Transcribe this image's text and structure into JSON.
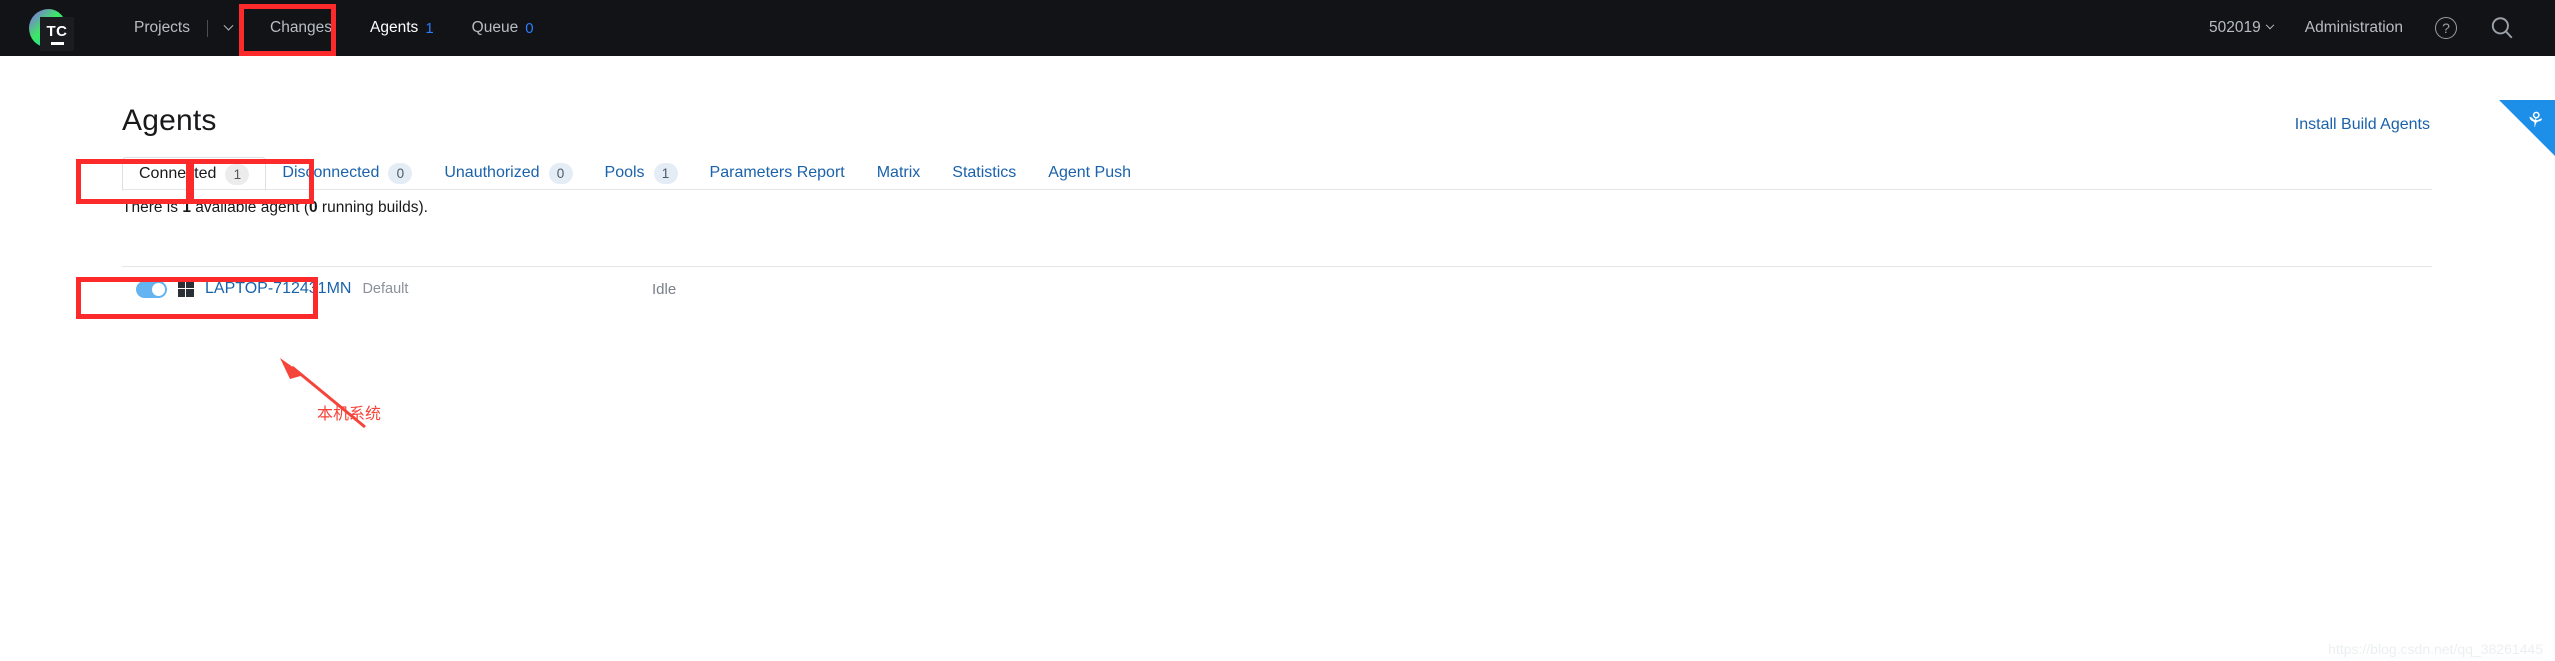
{
  "header": {
    "logo_text": "TC",
    "nav": [
      {
        "label": "Projects",
        "count": "",
        "has_divider": true,
        "has_chevron": true,
        "active": false,
        "name": "projects"
      },
      {
        "label": "Changes",
        "count": "",
        "has_divider": false,
        "has_chevron": false,
        "active": false,
        "name": "changes"
      },
      {
        "label": "Agents",
        "count": "1",
        "has_divider": false,
        "has_chevron": false,
        "active": true,
        "name": "agents"
      },
      {
        "label": "Queue",
        "count": "0",
        "has_divider": false,
        "has_chevron": false,
        "active": false,
        "name": "queue"
      }
    ],
    "user": "502019",
    "administration": "Administration",
    "help_icon": "?",
    "search_icon": "search-icon"
  },
  "page": {
    "title": "Agents",
    "install_link": "Install Build Agents",
    "ribbon_icon": "flask-icon"
  },
  "tabs": [
    {
      "label": "Connected",
      "badge": "1",
      "active": true
    },
    {
      "label": "Disconnected",
      "badge": "0",
      "active": false
    },
    {
      "label": "Unauthorized",
      "badge": "0",
      "active": false
    },
    {
      "label": "Pools",
      "badge": "1",
      "active": false
    },
    {
      "label": "Parameters Report",
      "badge": "",
      "active": false
    },
    {
      "label": "Matrix",
      "badge": "",
      "active": false
    },
    {
      "label": "Statistics",
      "badge": "",
      "active": false
    },
    {
      "label": "Agent Push",
      "badge": "",
      "active": false
    }
  ],
  "status": {
    "prefix": "There is ",
    "agent_count": "1",
    "middle": " available agent (",
    "build_count": "0",
    "suffix": " running builds)."
  },
  "agents": [
    {
      "enabled": true,
      "os": "windows-icon",
      "name": "LAPTOP-712431MN",
      "pool": "Default",
      "status": "Idle"
    }
  ],
  "annotation": {
    "note_text": "本机系统",
    "color": "#fc2a2a"
  },
  "watermark": "https://blog.csdn.net/qq_38261445"
}
